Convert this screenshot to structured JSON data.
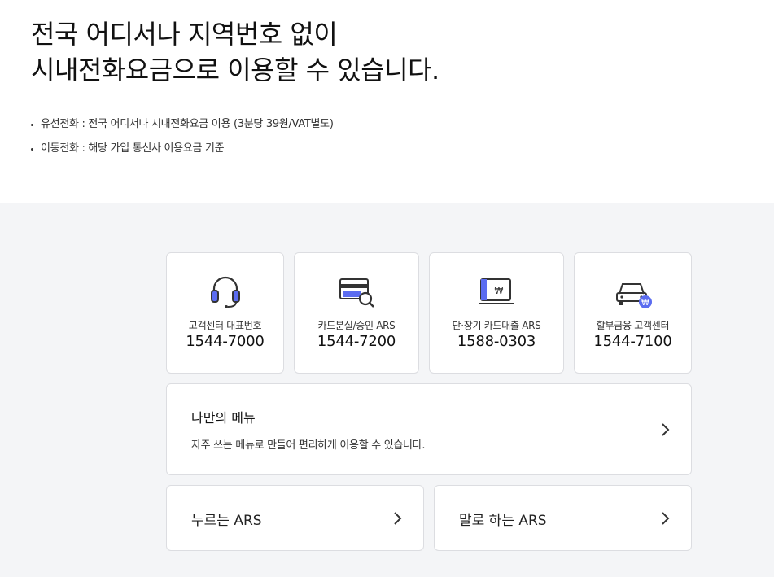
{
  "headline": {
    "line1": "전국 어디서나 지역번호 없이",
    "line2": "시내전화요금으로 이용할 수 있습니다."
  },
  "notes": [
    "유선전화 : 전국 어디서나 시내전화요금 이용 (3분당 39원/VAT별도)",
    "이동전화 : 해당 가입 통신사 이용요금 기준"
  ],
  "services": [
    {
      "label": "고객센터 대표번호",
      "number": "1544-7000",
      "icon": "headset-icon"
    },
    {
      "label": "카드분실/승인 ARS",
      "number": "1544-7200",
      "icon": "card-search-icon"
    },
    {
      "label": "단·장기 카드대출 ARS",
      "number": "1588-0303",
      "icon": "card-loan-won-icon"
    },
    {
      "label": "할부금융 고객센터",
      "number": "1544-7100",
      "icon": "car-won-icon"
    }
  ],
  "my_menu": {
    "title": "나만의 메뉴",
    "desc": "자주 쓰는 메뉴로 만들어 편리하게 이용할 수 있습니다."
  },
  "ars": {
    "press": "누르는 ARS",
    "voice": "말로 하는 ARS"
  },
  "colors": {
    "accent_blue": "#5b6cf0",
    "icon_dark": "#333333",
    "bg_gray": "#f4f5f7"
  }
}
